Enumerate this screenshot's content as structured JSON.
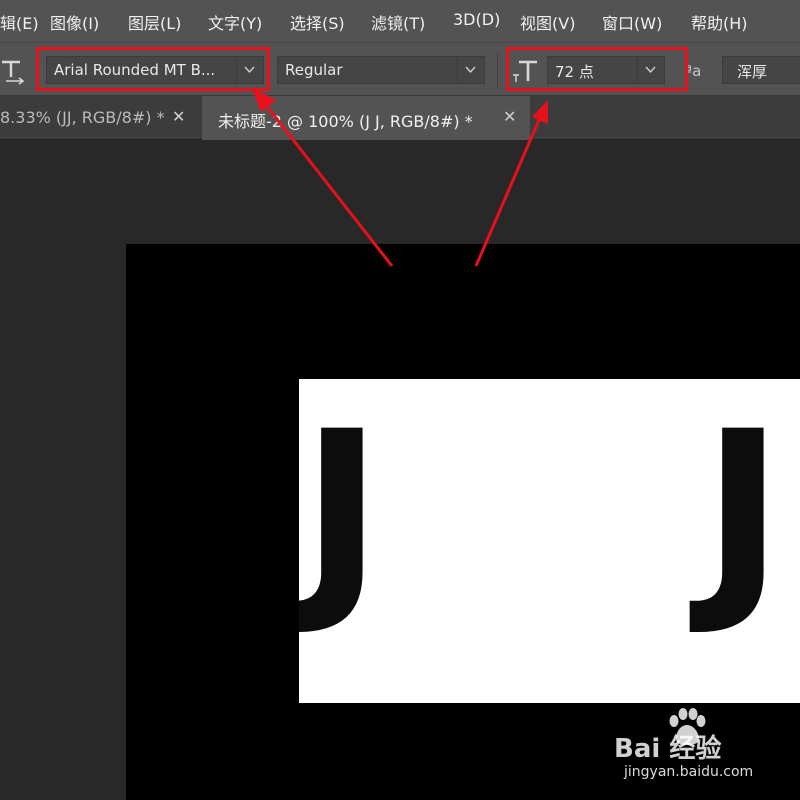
{
  "menu": {
    "items": [
      "辑(E)",
      "图像(I)",
      "图层(L)",
      "文字(Y)",
      "选择(S)",
      "滤镜(T)",
      "3D(D)",
      "视图(V)",
      "窗口(W)",
      "帮助(H)"
    ]
  },
  "options": {
    "font_family": "Arial Rounded MT B...",
    "font_style": "Regular",
    "font_size": "72 点",
    "anti_alias": "浑厚",
    "aa_glyph": "ªa"
  },
  "tabs": [
    {
      "title": "8.33% (JJ, RGB/8#) *",
      "close": "✕",
      "active": false
    },
    {
      "title": "未标题-2 @ 100% (J   J, RGB/8#) *",
      "close": "✕",
      "active": true
    }
  ],
  "canvas": {
    "text": [
      "J",
      "J"
    ]
  },
  "watermark": {
    "brand": "Bai  经验",
    "url": "jingyan.baidu.com"
  },
  "colors": {
    "highlight": "#e8101b",
    "panel": "#535353",
    "workspace": "#282828"
  }
}
